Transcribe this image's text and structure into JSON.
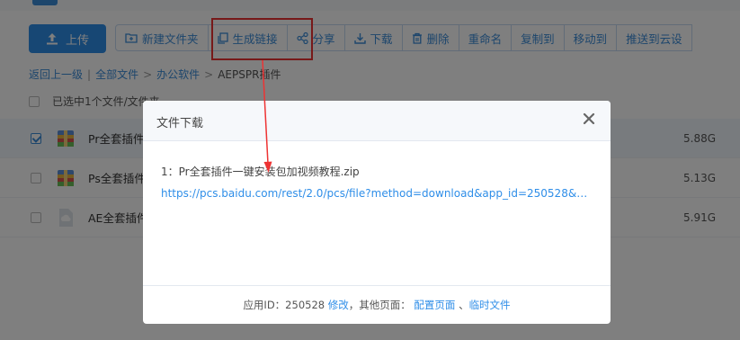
{
  "toolbar": {
    "upload_label": "上传",
    "buttons": [
      "新建文件夹",
      "生成链接",
      "分享",
      "下载",
      "删除",
      "重命名",
      "复制到",
      "移动到",
      "推送到云设"
    ]
  },
  "breadcrumb": {
    "back": "返回上一级",
    "all": "全部文件",
    "folder": "办公软件",
    "current": "AEPSPR插件"
  },
  "selection_info": "已选中1个文件/文件夹",
  "files": [
    {
      "name": "Pr全套插件",
      "size": "5.88G",
      "selected": true
    },
    {
      "name": "Ps全套插件",
      "size": "5.13G",
      "selected": false
    },
    {
      "name": "AE全套插件",
      "size": "5.91G",
      "selected": false
    }
  ],
  "dialog": {
    "title": "文件下载",
    "file_line": "1：Pr全套插件一键安装包加视频教程.zip",
    "link": "https://pcs.baidu.com/rest/2.0/pcs/file?method=download&app_id=250528&file...",
    "footer": {
      "app_id_label": "应用ID：250528",
      "modify": "修改",
      "other_pages": "，其他页面：",
      "config_page": "配置页面",
      "dot": "、",
      "temp_file": "临时文件"
    }
  },
  "colors": {
    "accent": "#2f8ee8",
    "highlight": "#e33333"
  }
}
